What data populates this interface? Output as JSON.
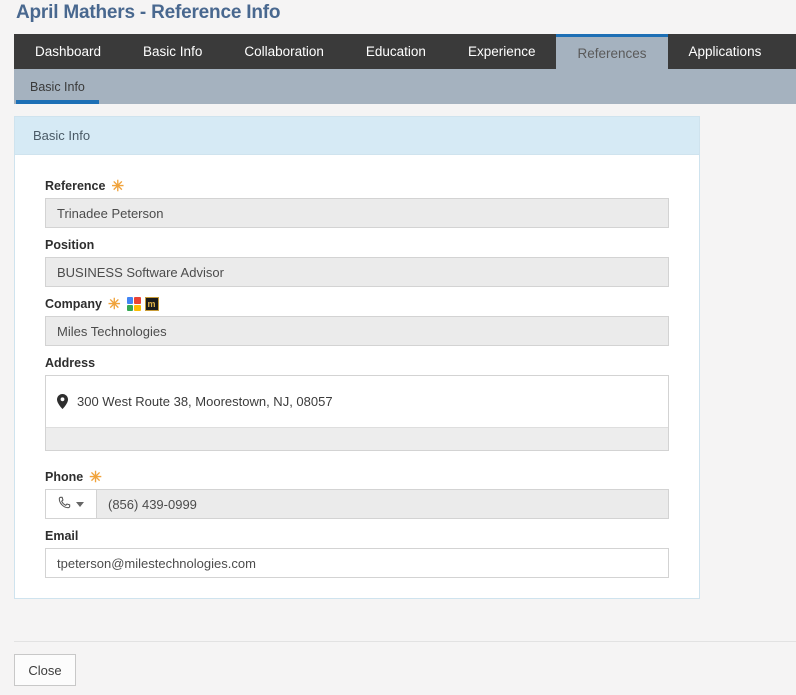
{
  "page": {
    "title": "April Mathers - Reference Info",
    "title_color": "#49688f",
    "background_color": "#f5f4f4"
  },
  "primary_tabs": {
    "active_color": "#1d6fb5",
    "bar_color": "#3a3a3a",
    "items": [
      {
        "label": "Dashboard",
        "active": false
      },
      {
        "label": "Basic Info",
        "active": false
      },
      {
        "label": "Collaboration",
        "active": false
      },
      {
        "label": "Education",
        "active": false
      },
      {
        "label": "Experience",
        "active": false
      },
      {
        "label": "References",
        "active": true
      },
      {
        "label": "Applications",
        "active": false
      }
    ]
  },
  "secondary_tabs": {
    "bar_color": "#a5b2bf",
    "items": [
      {
        "label": "Basic Info",
        "active": true
      }
    ]
  },
  "panel": {
    "header": "Basic Info",
    "header_color": "#d6eaf5"
  },
  "form": {
    "required_marker": "✳",
    "required_marker_color": "#f0a33c",
    "fields": {
      "reference": {
        "label": "Reference",
        "required": true,
        "value": "Trinadee Peterson",
        "readonly": true
      },
      "position": {
        "label": "Position",
        "required": false,
        "value": "BUSINESS Software Advisor",
        "readonly": true
      },
      "company": {
        "label": "Company",
        "required": true,
        "value": "Miles Technologies",
        "readonly": true,
        "icons": [
          {
            "name": "google-search-icon",
            "title": "Google"
          },
          {
            "name": "manta-directory-icon",
            "title": "m"
          }
        ]
      },
      "address": {
        "label": "Address",
        "required": false,
        "value": "300 West Route 38, Moorestown, NJ, 08057"
      },
      "phone": {
        "label": "Phone",
        "required": true,
        "value": "(856) 439-0999",
        "readonly": true,
        "type_selector": "phone"
      },
      "email": {
        "label": "Email",
        "required": false,
        "value": "tpeterson@milestechnologies.com",
        "readonly": false
      }
    }
  },
  "footer": {
    "close_label": "Close"
  }
}
